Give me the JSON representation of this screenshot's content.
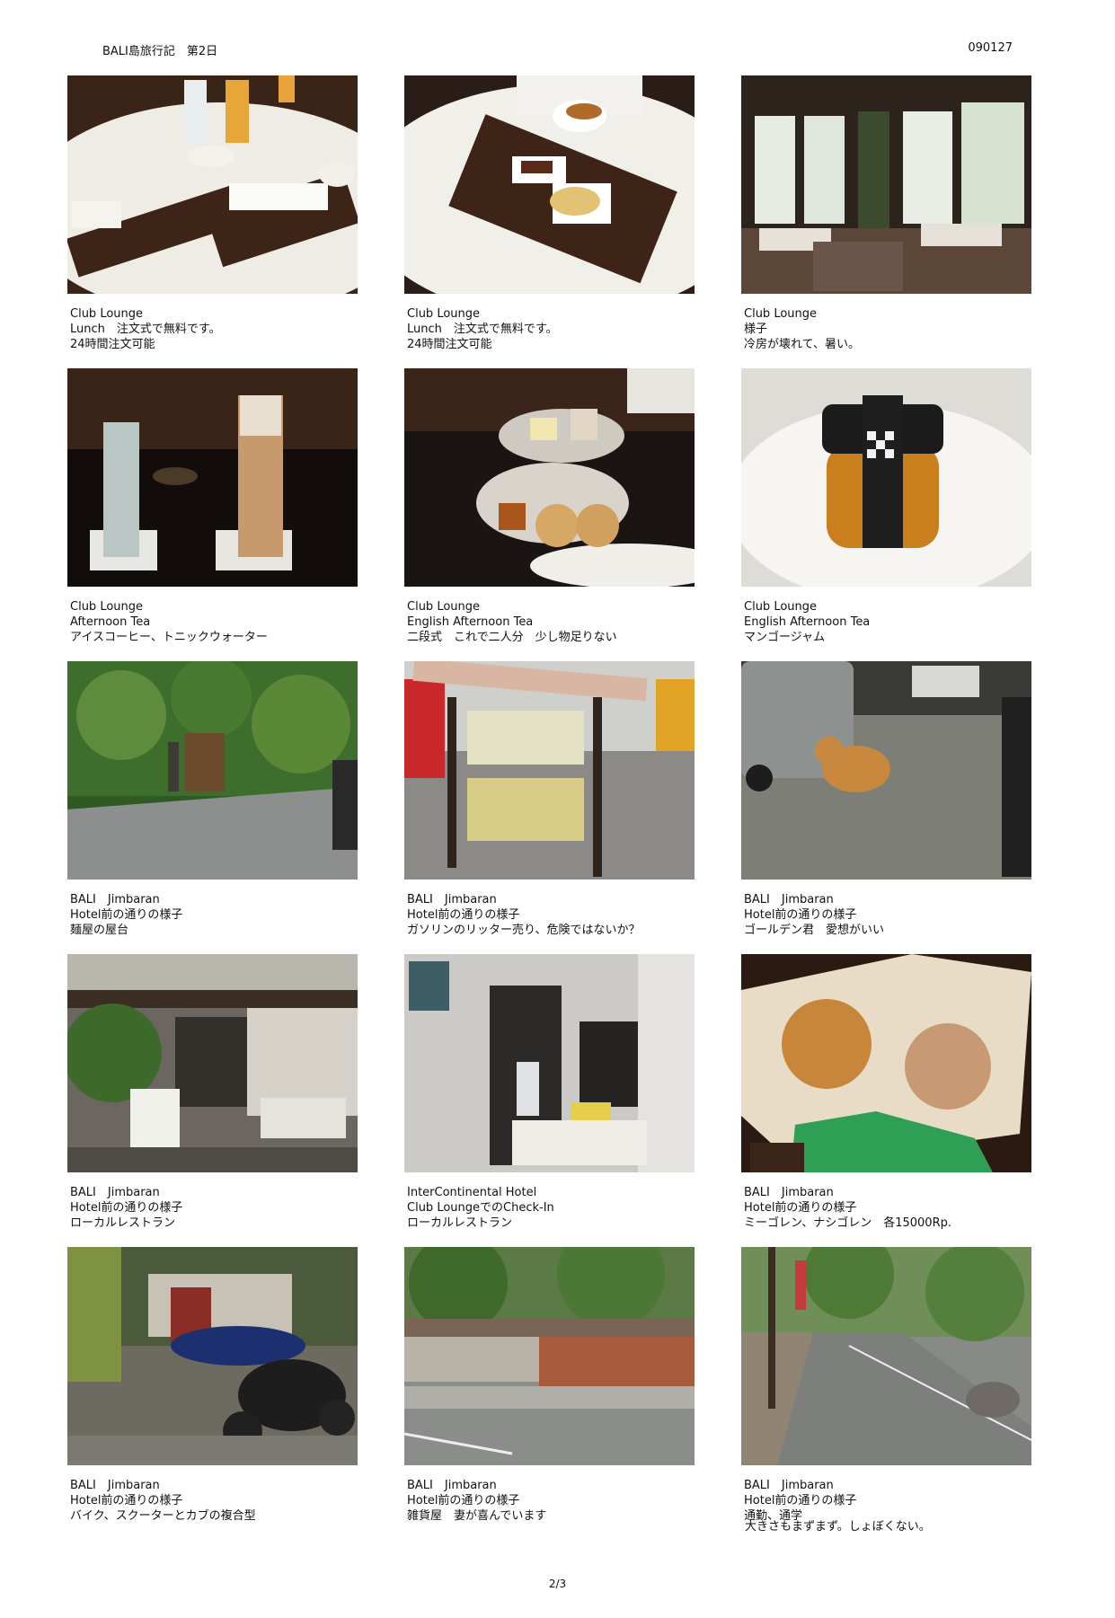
{
  "header": {
    "title": "BALI島旅行記　第2日",
    "code": "090127"
  },
  "photos": [
    {
      "icon": "lunch-platter-photo",
      "lines": [
        "Club Lounge",
        "Lunch　注文式で無料です。",
        "24時間注文可能"
      ]
    },
    {
      "icon": "lunch-plate-photo",
      "lines": [
        "Club Lounge",
        "Lunch　注文式で無料です。",
        "24時間注文可能"
      ]
    },
    {
      "icon": "lounge-interior-photo",
      "lines": [
        "Club Lounge",
        "様子",
        "冷房が壊れて、暑い。"
      ]
    },
    {
      "icon": "iced-drinks-photo",
      "lines": [
        "Club Lounge",
        "Afternoon Tea",
        "アイスコーヒー、トニックウォーター"
      ]
    },
    {
      "icon": "tea-stand-photo",
      "lines": [
        "Club Lounge",
        "English Afternoon Tea",
        "二段式　これで二人分　少し物足りない"
      ]
    },
    {
      "icon": "mango-jam-photo",
      "lines": [
        "Club Lounge",
        "English Afternoon Tea",
        "マンゴージャム"
      ]
    },
    {
      "icon": "noodle-cart-photo",
      "lines": [
        "BALI　Jimbaran",
        "Hotel前の通りの様子",
        "麺屋の屋台"
      ]
    },
    {
      "icon": "petrol-bottles-photo",
      "lines": [
        "BALI　Jimbaran",
        "Hotel前の通りの様子",
        "ガソリンのリッター売り、危険ではないか？"
      ]
    },
    {
      "icon": "golden-dog-photo",
      "lines": [
        "BALI　Jimbaran",
        "Hotel前の通りの様子",
        "ゴールデン君　愛想がいい"
      ]
    },
    {
      "icon": "local-restaurant-photo",
      "lines": [
        "BALI　Jimbaran",
        "Hotel前の通りの様子",
        "ローカルレストラン"
      ]
    },
    {
      "icon": "restaurant-kitchen-photo",
      "lines": [
        "InterContinental Hotel",
        "Club LoungeでのCheck-In",
        "ローカルレストラン"
      ]
    },
    {
      "icon": "mie-goreng-photo",
      "lines": [
        "BALI　Jimbaran",
        "Hotel前の通りの様子",
        "ミーゴレン、ナシゴレン　各15000Rp."
      ]
    },
    {
      "icon": "motorbikes-photo",
      "lines": [
        "BALI　Jimbaran",
        "Hotel前の通りの様子",
        "バイク、スクーターとカブの複合型"
      ]
    },
    {
      "icon": "general-store-photo",
      "lines": [
        "BALI　Jimbaran",
        "Hotel前の通りの様子",
        "雑貨屋　妻が喜んでいます"
      ]
    },
    {
      "icon": "street-commute-photo",
      "lines": [
        "BALI　Jimbaran",
        "Hotel前の通りの様子",
        "通勤、通学"
      ]
    }
  ],
  "extra_note": "大きさもまずまず。しょぼくない。",
  "footer": {
    "page": "2/3"
  }
}
